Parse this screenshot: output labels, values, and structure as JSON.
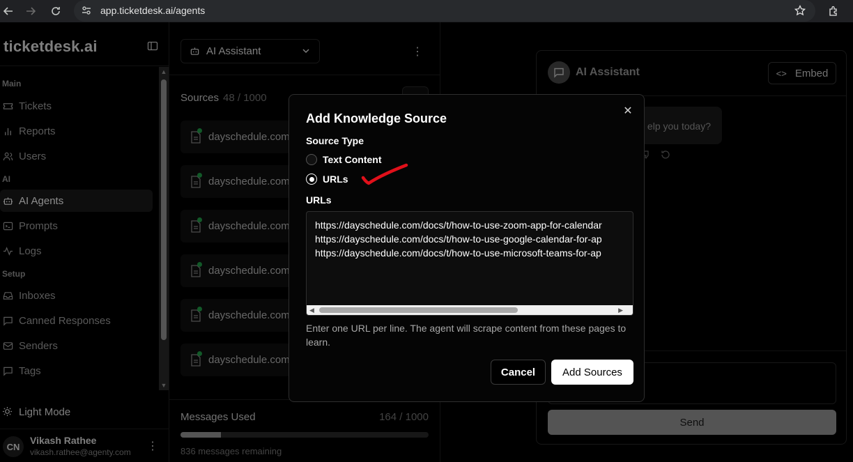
{
  "browser": {
    "url": "app.ticketdesk.ai/agents"
  },
  "sidebar": {
    "brand": "ticketdesk.ai",
    "sections": {
      "main": "Main",
      "ai": "AI",
      "setup": "Setup"
    },
    "items": [
      {
        "label": "Tickets",
        "icon": "ticket-icon"
      },
      {
        "label": "Reports",
        "icon": "bar-chart-icon"
      },
      {
        "label": "Users",
        "icon": "users-icon"
      },
      {
        "label": "AI Agents",
        "icon": "bot-icon"
      },
      {
        "label": "Prompts",
        "icon": "terminal-icon"
      },
      {
        "label": "Logs",
        "icon": "activity-icon"
      },
      {
        "label": "Inboxes",
        "icon": "inbox-icon"
      },
      {
        "label": "Canned Responses",
        "icon": "message-square-icon"
      },
      {
        "label": "Senders",
        "icon": "mail-icon"
      },
      {
        "label": "Tags",
        "icon": "tag-icon"
      }
    ],
    "light_mode": "Light Mode",
    "user": {
      "initials": "CN",
      "name": "Vikash Rathee",
      "email": "vikash.rathee@agenty.com"
    }
  },
  "middle": {
    "agent_select": "AI Assistant",
    "sources_title": "Sources",
    "sources_count": "48 / 1000",
    "sources": [
      "dayschedule.com",
      "dayschedule.com",
      "dayschedule.com",
      "dayschedule.com",
      "dayschedule.com",
      "dayschedule.com"
    ],
    "messages_used_label": "Messages Used",
    "messages_used_count": "164 / 1000",
    "messages_used_fraction": 0.164,
    "messages_remaining": "836 messages remaining"
  },
  "chat": {
    "title": "AI Assistant",
    "embed_label": "Embed",
    "bubble_text": "elp you today?",
    "send_label": "Send"
  },
  "modal": {
    "title": "Add Knowledge Source",
    "source_type_label": "Source Type",
    "options": [
      {
        "label": "Text Content",
        "selected": false
      },
      {
        "label": "URLs",
        "selected": true
      }
    ],
    "urls_label": "URLs",
    "urls": [
      "https://dayschedule.com/docs/t/how-to-use-zoom-app-for-calendar",
      "https://dayschedule.com/docs/t/how-to-use-google-calendar-for-ap",
      "https://dayschedule.com/docs/t/how-to-use-microsoft-teams-for-ap"
    ],
    "hint": "Enter one URL per line. The agent will scrape content from these pages to learn.",
    "cancel_label": "Cancel",
    "submit_label": "Add Sources"
  },
  "colors": {
    "annotation": "#e0101a",
    "status_dot": "#22a34a"
  }
}
